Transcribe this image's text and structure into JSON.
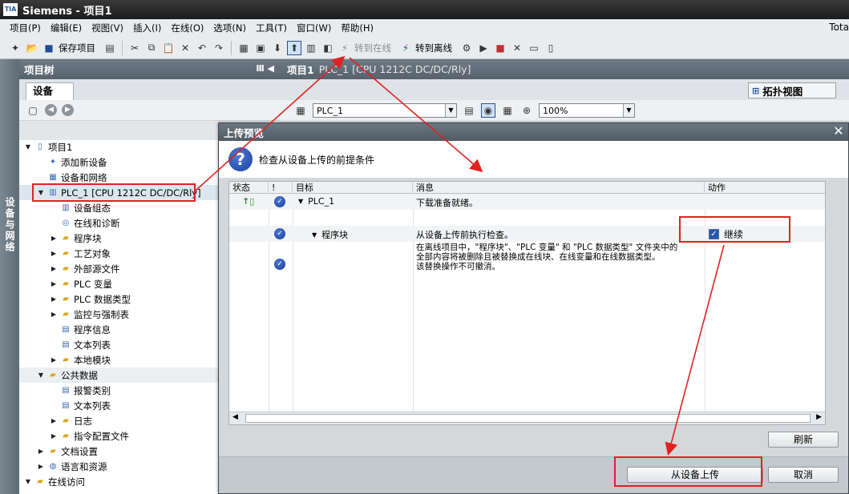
{
  "window": {
    "app_logo": "TIA",
    "title": "Siemens  -  项目1"
  },
  "menu": {
    "items": [
      "项目(P)",
      "编辑(E)",
      "视图(V)",
      "插入(I)",
      "在线(O)",
      "选项(N)",
      "工具(T)",
      "窗口(W)",
      "帮助(H)"
    ],
    "right_text": "Tota"
  },
  "toolbar": {
    "save_project": "保存项目",
    "go_online": "转到在线",
    "go_offline": "转到离线"
  },
  "left_vertical_tab": "设备与网络",
  "project_tree": {
    "title": "项目树",
    "tab": "设备",
    "items": [
      {
        "label": "项目1",
        "level": 0,
        "expander": "▼",
        "icon": "project-icon"
      },
      {
        "label": "添加新设备",
        "level": 1,
        "expander": "",
        "icon": "add-device-icon"
      },
      {
        "label": "设备和网络",
        "level": 1,
        "expander": "",
        "icon": "network-icon"
      },
      {
        "label": "PLC_1 [CPU 1212C DC/DC/Rly]",
        "level": 1,
        "expander": "▼",
        "icon": "plc-icon"
      },
      {
        "label": "设备组态",
        "level": 2,
        "expander": "",
        "icon": "device-config-icon"
      },
      {
        "label": "在线和诊断",
        "level": 2,
        "expander": "",
        "icon": "diagnostics-icon"
      },
      {
        "label": "程序块",
        "level": 2,
        "expander": "▶",
        "icon": "folder-icon"
      },
      {
        "label": "工艺对象",
        "level": 2,
        "expander": "▶",
        "icon": "folder-icon"
      },
      {
        "label": "外部源文件",
        "level": 2,
        "expander": "▶",
        "icon": "folder-icon"
      },
      {
        "label": "PLC 变量",
        "level": 2,
        "expander": "▶",
        "icon": "folder-icon"
      },
      {
        "label": "PLC 数据类型",
        "level": 2,
        "expander": "▶",
        "icon": "folder-icon"
      },
      {
        "label": "监控与强制表",
        "level": 2,
        "expander": "▶",
        "icon": "folder-icon"
      },
      {
        "label": "程序信息",
        "level": 2,
        "expander": "",
        "icon": "program-info-icon"
      },
      {
        "label": "文本列表",
        "level": 2,
        "expander": "",
        "icon": "text-list-icon"
      },
      {
        "label": "本地模块",
        "level": 2,
        "expander": "▶",
        "icon": "folder-icon"
      },
      {
        "label": "公共数据",
        "level": 1,
        "expander": "▼",
        "icon": "folder-icon"
      },
      {
        "label": "报警类别",
        "level": 2,
        "expander": "",
        "icon": "alarm-icon"
      },
      {
        "label": "文本列表",
        "level": 2,
        "expander": "",
        "icon": "text-list-icon"
      },
      {
        "label": "日志",
        "level": 2,
        "expander": "▶",
        "icon": "folder-icon"
      },
      {
        "label": "指令配置文件",
        "level": 2,
        "expander": "▶",
        "icon": "folder-icon"
      },
      {
        "label": "文档设置",
        "level": 1,
        "expander": "▶",
        "icon": "folder-icon"
      },
      {
        "label": "语言和资源",
        "level": 1,
        "expander": "▶",
        "icon": "language-icon"
      },
      {
        "label": "在线访问",
        "level": 0,
        "expander": "▼",
        "icon": "folder-icon"
      }
    ]
  },
  "editor": {
    "title": "项目1",
    "subtitle": "PLC_1 [CPU 1212C DC/DC/Rly]",
    "topology_view": "拓扑视图",
    "device_combo": "PLC_1",
    "zoom": "100%"
  },
  "dialog": {
    "title": "上传预览",
    "header": "检查从设备上传的前提条件",
    "columns": {
      "status": "状态",
      "bang": "!",
      "target": "目标",
      "message": "消息",
      "action": "动作"
    },
    "rows": [
      {
        "target": "PLC_1",
        "message": "下载准备就绪。",
        "action": ""
      },
      {
        "target": "程序块",
        "message": "从设备上传前执行检查。",
        "action": "继续"
      },
      {
        "target": "",
        "message": "在离线项目中，\"程序块\"、\"PLC 变量\" 和 \"PLC 数据类型\" 文件夹中的\n全部内容将被删除且被替换成在线块、在线变量和在线数据类型。\n该替换操作不可撤消。",
        "action": ""
      }
    ],
    "refresh": "刷新",
    "upload": "从设备上传",
    "cancel": "取消"
  },
  "colors": {
    "annotation_red": "#e02222",
    "header_gray": "#56626c"
  }
}
